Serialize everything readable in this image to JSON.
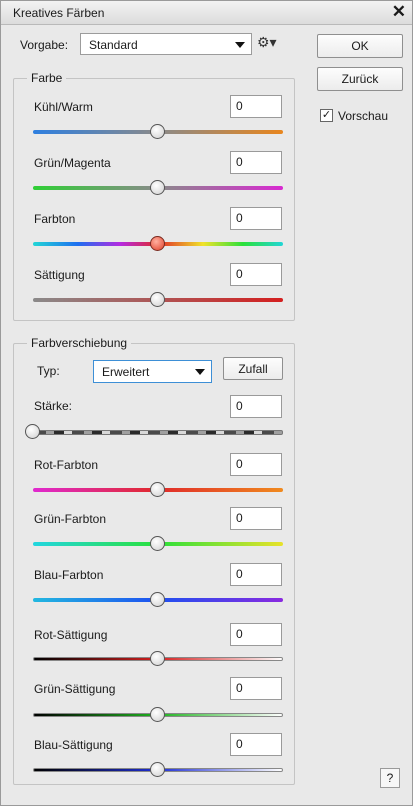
{
  "window": {
    "title": "Kreatives Färben"
  },
  "preset": {
    "label": "Vorgabe:",
    "value": "Standard"
  },
  "buttons": {
    "ok": "OK",
    "back": "Zurück",
    "random": "Zufall",
    "help": "?"
  },
  "preview": {
    "label": "Vorschau",
    "checked": true
  },
  "color_group": {
    "title": "Farbe",
    "sliders": [
      {
        "label": "Kühl/Warm",
        "value": "0"
      },
      {
        "label": "Grün/Magenta",
        "value": "0"
      },
      {
        "label": "Farbton",
        "value": "0"
      },
      {
        "label": "Sättigung",
        "value": "0"
      }
    ]
  },
  "shift_group": {
    "title": "Farbverschiebung",
    "type_label": "Typ:",
    "type_value": "Erweitert",
    "strength": {
      "label": "Stärke:",
      "value": "0"
    },
    "sliders": [
      {
        "label": "Rot-Farbton",
        "value": "0"
      },
      {
        "label": "Grün-Farbton",
        "value": "0"
      },
      {
        "label": "Blau-Farbton",
        "value": "0"
      },
      {
        "label": "Rot-Sättigung",
        "value": "0"
      },
      {
        "label": "Grün-Sättigung",
        "value": "0"
      },
      {
        "label": "Blau-Sättigung",
        "value": "0"
      }
    ]
  },
  "icons": {
    "close": "close-icon",
    "gear": "gear-icon",
    "dropdown": "chevron-down-icon",
    "checkmark": "checkmark-icon"
  },
  "colors": {
    "accent_focus": "#3d8fd6",
    "farbton_thumb": "#e0402a"
  }
}
